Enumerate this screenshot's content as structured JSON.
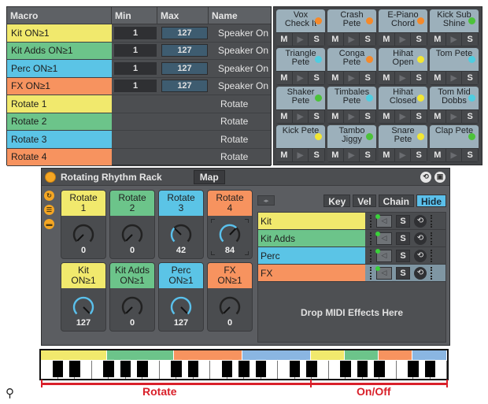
{
  "colors": {
    "yellow": "#f1e96d",
    "green": "#6cc48a",
    "blue": "#5bc4e6",
    "orange": "#f7935f",
    "strip_blue": "#8ab6e2",
    "accent_orange": "#f5a623",
    "annotation_red": "#d9202a"
  },
  "macro_table": {
    "headers": [
      "Macro",
      "Min",
      "Max",
      "Name"
    ],
    "rows": [
      {
        "macro": "Kit ON≥1",
        "color": "yellow",
        "min": "1",
        "max": "127",
        "name": "Speaker On"
      },
      {
        "macro": "Kit Adds ON≥1",
        "color": "green",
        "min": "1",
        "max": "127",
        "name": "Speaker On"
      },
      {
        "macro": "Perc ON≥1",
        "color": "blue",
        "min": "1",
        "max": "127",
        "name": "Speaker On"
      },
      {
        "macro": "FX ON≥1",
        "color": "orange",
        "min": "1",
        "max": "127",
        "name": "Speaker On"
      },
      {
        "macro": "Rotate  1",
        "color": "yellow",
        "min": "",
        "max": "",
        "name": "Rotate"
      },
      {
        "macro": "Rotate  2",
        "color": "green",
        "min": "",
        "max": "",
        "name": "Rotate"
      },
      {
        "macro": "Rotate  3",
        "color": "blue",
        "min": "",
        "max": "",
        "name": "Rotate"
      },
      {
        "macro": "Rotate  4",
        "color": "orange",
        "min": "",
        "max": "",
        "name": "Rotate"
      }
    ]
  },
  "drum_pads": {
    "button_labels": {
      "mute": "M",
      "play": "▶",
      "solo": "S"
    },
    "pads": [
      {
        "line1": "Vox",
        "line2": "Check It",
        "dot": "#f5892a"
      },
      {
        "line1": "Crash",
        "line2": "Pete",
        "dot": "#f5892a"
      },
      {
        "line1": "E-Piano",
        "line2": "Chord",
        "dot": "#f5892a"
      },
      {
        "line1": "Kick Sub",
        "line2": "Shine",
        "dot": "#4cc23a"
      },
      {
        "line1": "Triangle",
        "line2": "Pete",
        "dot": "#4fcde0"
      },
      {
        "line1": "Conga",
        "line2": "Pete",
        "dot": "#f5892a"
      },
      {
        "line1": "Hihat",
        "line2": "Open",
        "dot": "#f2e632"
      },
      {
        "line1": "Tom Pete",
        "line2": "",
        "dot": "#4fcde0"
      },
      {
        "line1": "Shaker",
        "line2": "Pete",
        "dot": "#4cc23a"
      },
      {
        "line1": "Timbales",
        "line2": "Pete",
        "dot": "#4fcde0"
      },
      {
        "line1": "Hihat",
        "line2": "Closed",
        "dot": "#f2e632"
      },
      {
        "line1": "Tom Mid",
        "line2": "Dobbs",
        "dot": "#4fcde0"
      },
      {
        "line1": "Kick Pete",
        "line2": "",
        "dot": "#f2e632"
      },
      {
        "line1": "Tambo",
        "line2": "Jiggy",
        "dot": "#4cc23a"
      },
      {
        "line1": "Snare",
        "line2": "Pete",
        "dot": "#f2e632"
      },
      {
        "line1": "Clap Pete",
        "line2": "",
        "dot": "#4cc23a"
      }
    ]
  },
  "rack": {
    "title": "Rotating Rhythm Rack",
    "map_label": "Map",
    "macros": [
      {
        "line1": "Rotate",
        "line2": "1",
        "color": "yellow",
        "value": 0,
        "max": 127
      },
      {
        "line1": "Rotate",
        "line2": "2",
        "color": "green",
        "value": 0,
        "max": 127
      },
      {
        "line1": "Rotate",
        "line2": "3",
        "color": "blue",
        "value": 42,
        "max": 127
      },
      {
        "line1": "Rotate",
        "line2": "4",
        "color": "orange",
        "value": 84,
        "max": 127
      },
      {
        "line1": "Kit",
        "line2": "ON≥1",
        "color": "yellow",
        "value": 127,
        "max": 127
      },
      {
        "line1": "Kit Adds",
        "line2": "ON≥1",
        "color": "green",
        "value": 0,
        "max": 127
      },
      {
        "line1": "Perc",
        "line2": "ON≥1",
        "color": "blue",
        "value": 127,
        "max": 127
      },
      {
        "line1": "FX",
        "line2": "ON≥1",
        "color": "orange",
        "value": 0,
        "max": 127
      }
    ],
    "chain_tabs": [
      "Key",
      "Vel",
      "Chain",
      "Hide"
    ],
    "active_tab": "Hide",
    "chains": [
      {
        "name": "Kit",
        "color": "yellow",
        "solo": "S"
      },
      {
        "name": "Kit Adds",
        "color": "green",
        "solo": "S"
      },
      {
        "name": "Perc",
        "color": "blue",
        "solo": "S"
      },
      {
        "name": "FX",
        "color": "orange",
        "solo": "S"
      }
    ],
    "drop_text": "Drop MIDI Effects Here"
  },
  "keyboard": {
    "zones": [
      "yellow",
      "green",
      "orange",
      "strip_blue",
      "yellow",
      "green",
      "orange",
      "strip_blue"
    ]
  },
  "annotations": {
    "rotate_label": "Rotate",
    "onoff_label": "On/Off"
  }
}
